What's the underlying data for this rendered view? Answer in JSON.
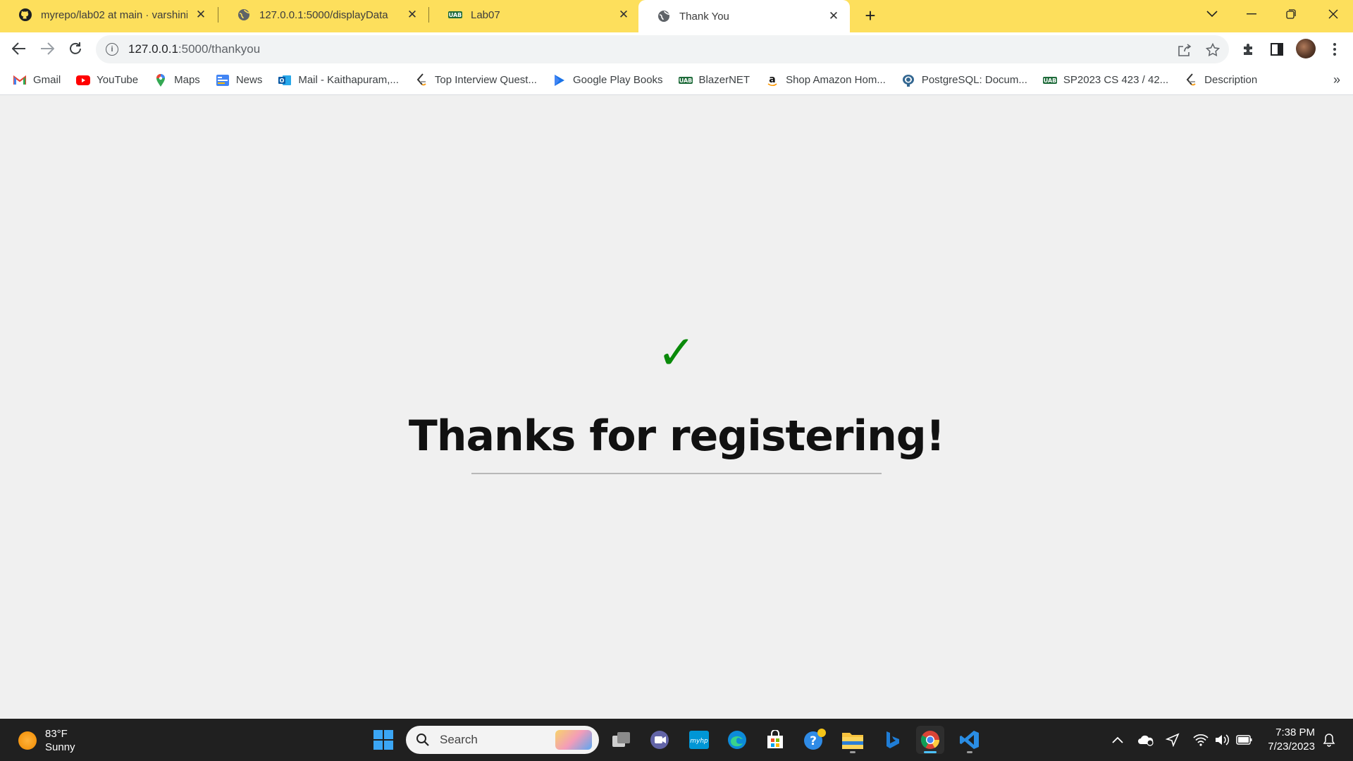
{
  "tabs": [
    {
      "title": "myrepo/lab02 at main · varshinik",
      "icon": "github-icon"
    },
    {
      "title": "127.0.0.1:5000/displayData",
      "icon": "globe-icon"
    },
    {
      "title": "Lab07",
      "icon": "uab-icon"
    },
    {
      "title": "Thank You",
      "icon": "globe-icon",
      "active": true
    }
  ],
  "omnibox": {
    "url_host": "127.0.0.1",
    "url_path": ":5000/thankyou"
  },
  "bookmarks": [
    {
      "label": "Gmail",
      "icon": "gmail-icon"
    },
    {
      "label": "YouTube",
      "icon": "youtube-icon"
    },
    {
      "label": "Maps",
      "icon": "maps-icon"
    },
    {
      "label": "News",
      "icon": "news-icon"
    },
    {
      "label": "Mail - Kaithapuram,...",
      "icon": "outlook-icon"
    },
    {
      "label": "Top Interview Quest...",
      "icon": "leetcode-icon"
    },
    {
      "label": "Google Play Books",
      "icon": "play-books-icon"
    },
    {
      "label": "BlazerNET",
      "icon": "uab-icon"
    },
    {
      "label": "Shop Amazon Hom...",
      "icon": "amazon-icon"
    },
    {
      "label": "PostgreSQL: Docum...",
      "icon": "postgresql-icon"
    },
    {
      "label": "SP2023 CS 423 / 42...",
      "icon": "uab-icon"
    },
    {
      "label": "Description",
      "icon": "leetcode-icon"
    }
  ],
  "page": {
    "checkmark": "✓",
    "heading": "Thanks for registering!"
  },
  "taskbar": {
    "weather_temp": "83°F",
    "weather_desc": "Sunny",
    "search_label": "Search",
    "time": "7:38 PM",
    "date": "7/23/2023"
  },
  "colors": {
    "tabstrip": "#fddf5c",
    "checkmark": "#0a8a0a",
    "taskbar": "#202020"
  }
}
